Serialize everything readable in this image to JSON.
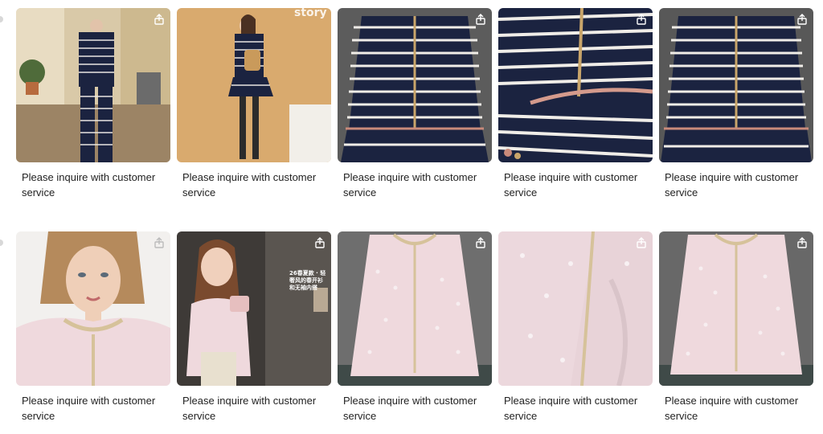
{
  "colors": {
    "navy": "#1b2340",
    "stripe": "#e9e6e2",
    "pink": "#efd9dd",
    "caption": "#222222"
  },
  "products": [
    {
      "id": "p1",
      "caption": "Please inquire with customer service",
      "scene": "runway-striped"
    },
    {
      "id": "p2",
      "caption": "Please inquire with customer service",
      "scene": "studio-striped",
      "overlay": "story"
    },
    {
      "id": "p3",
      "caption": "Please inquire with customer service",
      "scene": "flat-striped"
    },
    {
      "id": "p4",
      "caption": "Please inquire with customer service",
      "scene": "detail-striped"
    },
    {
      "id": "p5",
      "caption": "Please inquire with customer service",
      "scene": "flat-striped"
    },
    {
      "id": "p6",
      "caption": "Please inquire with customer service",
      "scene": "model-pink"
    },
    {
      "id": "p7",
      "caption": "Please inquire with customer service",
      "scene": "elevator-pink",
      "overlay": "26春夏款 · 轻奢风的春开衫和无袖内搭"
    },
    {
      "id": "p8",
      "caption": "Please inquire with customer service",
      "scene": "hanger-pink"
    },
    {
      "id": "p9",
      "caption": "Please inquire with customer service",
      "scene": "detail-pink"
    },
    {
      "id": "p10",
      "caption": "Please inquire with customer service",
      "scene": "hanger-pink"
    }
  ],
  "icons": {
    "share": "share-icon"
  }
}
